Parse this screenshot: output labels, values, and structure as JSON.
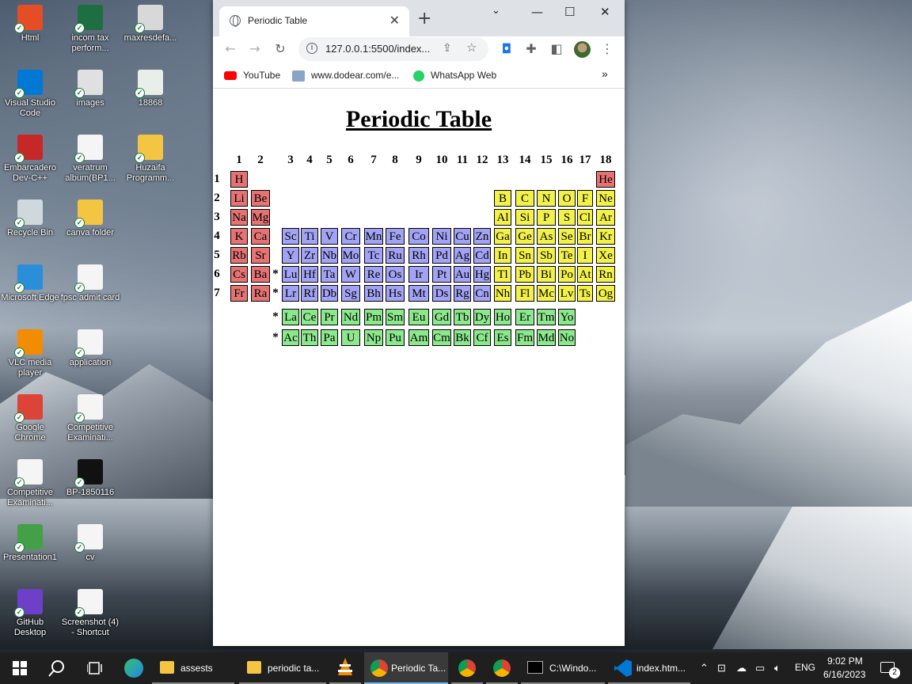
{
  "desktop": {
    "icons": [
      {
        "label": "Html",
        "color": "#e44d26"
      },
      {
        "label": "incom tax perform...",
        "color": "#1d6f42"
      },
      {
        "label": "maxresdefa...",
        "color": "#d8d8d8"
      },
      {
        "label": "Visual Studio Code",
        "color": "#0078d4"
      },
      {
        "label": "images",
        "color": "#e0e0e0"
      },
      {
        "label": "18868",
        "color": "#e8eee8"
      },
      {
        "label": "Embarcadero Dev-C++",
        "color": "#c62828"
      },
      {
        "label": "veratrum album(BP1...",
        "color": "#f5f5f5"
      },
      {
        "label": "Huzaifa Programm...",
        "color": "#f4c542"
      },
      {
        "label": "Recycle Bin",
        "color": "#cfd8dc"
      },
      {
        "label": "canva folder",
        "color": "#f4c542"
      },
      {
        "label": "Microsoft Edge",
        "color": "#2a8fd8"
      },
      {
        "label": "fpsc admit card",
        "color": "#f5f5f5"
      },
      {
        "label": "VLC media player",
        "color": "#f28c00"
      },
      {
        "label": "application",
        "color": "#f5f5f5"
      },
      {
        "label": "Google Chrome",
        "color": "#db4437"
      },
      {
        "label": "Competitive Examinati...",
        "color": "#f5f5f5"
      },
      {
        "label": "Competitive Examinati...",
        "color": "#f5f5f5"
      },
      {
        "label": "BP-1850116",
        "color": "#111111"
      },
      {
        "label": "Presentation1",
        "color": "#43a047"
      },
      {
        "label": "cv",
        "color": "#f5f5f5"
      },
      {
        "label": "GitHub Desktop",
        "color": "#6e40c9"
      },
      {
        "label": "Screenshot (4) - Shortcut",
        "color": "#f5f5f5"
      }
    ]
  },
  "browser": {
    "tab_title": "Periodic Table",
    "tab_close": "✕",
    "new_tab": "+",
    "url": "127.0.0.1:5500/index...",
    "bookmarks": [
      "YouTube",
      "www.dodear.com/e...",
      "WhatsApp Web"
    ],
    "bookmarks_more": "»"
  },
  "page": {
    "heading": "Periodic Table",
    "groups": [
      "1",
      "2",
      "3",
      "4",
      "5",
      "6",
      "7",
      "8",
      "9",
      "10",
      "11",
      "12",
      "13",
      "14",
      "15",
      "16",
      "17",
      "18"
    ],
    "periods": [
      "1",
      "2",
      "3",
      "4",
      "5",
      "6",
      "7"
    ],
    "star": "*",
    "colors": {
      "alkali": "#e57373",
      "transition": "#a3a3f5",
      "main": "#f2f04a",
      "f_block": "#8ce88c"
    },
    "rows": [
      [
        "H",
        "",
        "",
        "",
        "",
        "",
        "",
        "",
        "",
        "",
        "",
        "",
        "",
        "",
        "",
        "",
        "",
        "He"
      ],
      [
        "Li",
        "Be",
        "",
        "",
        "",
        "",
        "",
        "",
        "",
        "",
        "",
        "",
        "B",
        "C",
        "N",
        "O",
        "F",
        "Ne"
      ],
      [
        "Na",
        "Mg",
        "",
        "",
        "",
        "",
        "",
        "",
        "",
        "",
        "",
        "",
        "Al",
        "Si",
        "P",
        "S",
        "Cl",
        "Ar"
      ],
      [
        "K",
        "Ca",
        "Sc",
        "Ti",
        "V",
        "Cr",
        "Mn",
        "Fe",
        "Co",
        "Ni",
        "Cu",
        "Zn",
        "Ga",
        "Ge",
        "As",
        "Se",
        "Br",
        "Kr"
      ],
      [
        "Rb",
        "Sr",
        "Y",
        "Zr",
        "Nb",
        "Mo",
        "Tc",
        "Ru",
        "Rh",
        "Pd",
        "Ag",
        "Cd",
        "In",
        "Sn",
        "Sb",
        "Te",
        "I",
        "Xe"
      ],
      [
        "Cs",
        "Ba",
        "Lu",
        "Hf",
        "Ta",
        "W",
        "Re",
        "Os",
        "Ir",
        "Pt",
        "Au",
        "Hg",
        "Tl",
        "Pb",
        "Bi",
        "Po",
        "At",
        "Rn"
      ],
      [
        "Fr",
        "Ra",
        "Lr",
        "Rf",
        "Db",
        "Sg",
        "Bh",
        "Hs",
        "Mt",
        "Ds",
        "Rg",
        "Cn",
        "Nh",
        "Fl",
        "Mc",
        "Lv",
        "Ts",
        "Og"
      ]
    ],
    "lanthanides": [
      "La",
      "Ce",
      "Pr",
      "Nd",
      "Pm",
      "Sm",
      "Eu",
      "Gd",
      "Tb",
      "Dy",
      "Ho",
      "Er",
      "Tm",
      "Yo"
    ],
    "actinides": [
      "Ac",
      "Th",
      "Pa",
      "U",
      "Np",
      "Pu",
      "Am",
      "Cm",
      "Bk",
      "Cf",
      "Es",
      "Fm",
      "Md",
      "No"
    ]
  },
  "taskbar": {
    "items": [
      "assests",
      "periodic ta...",
      "Periodic Ta...",
      "C:\\Windo...",
      "index.htm..."
    ],
    "lang": "ENG",
    "time": "9:02 PM",
    "date": "6/16/2023",
    "notifications": "2"
  }
}
